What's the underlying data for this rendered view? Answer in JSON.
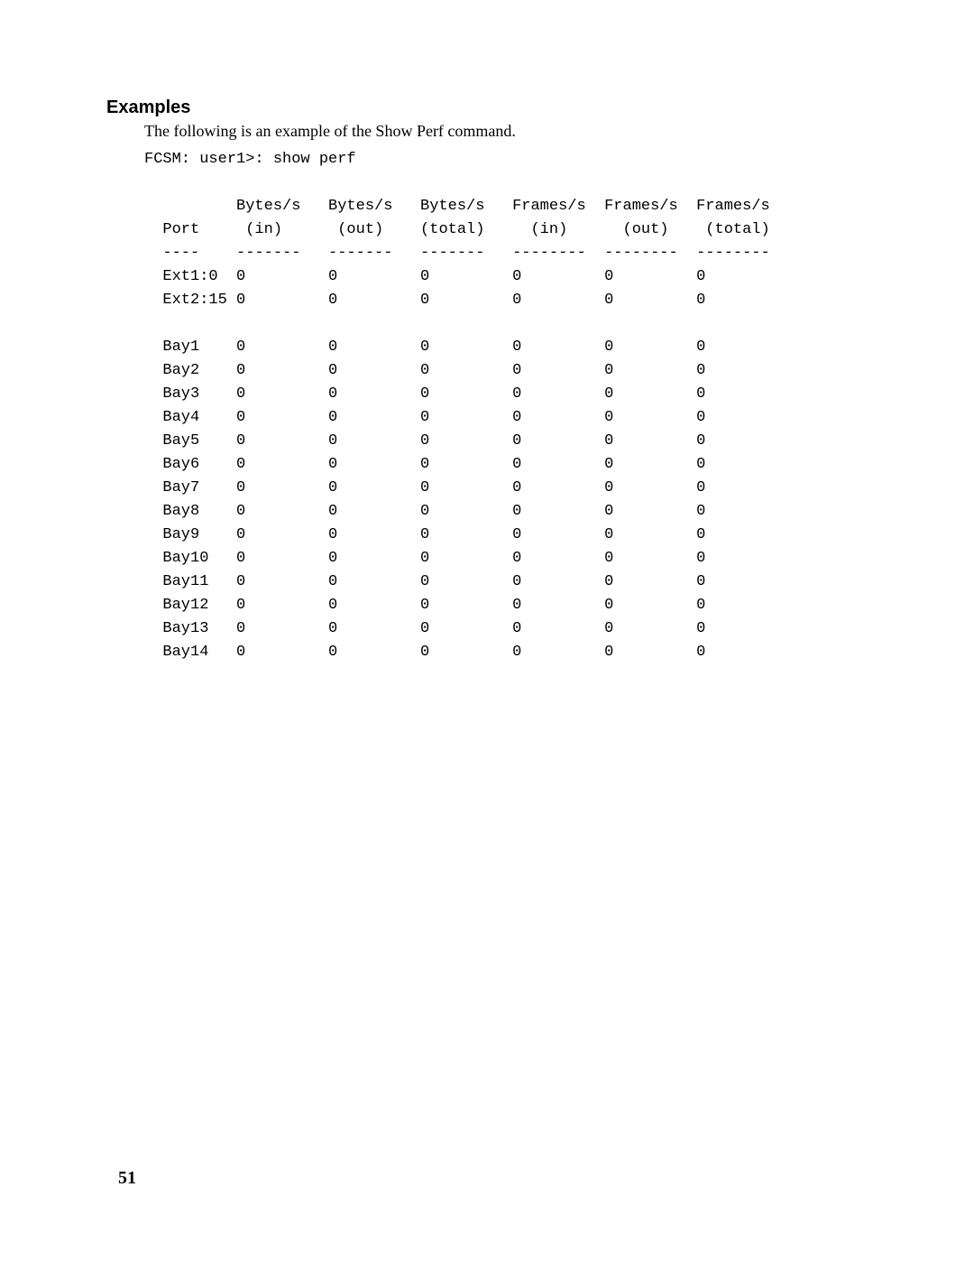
{
  "heading": "Examples",
  "intro": "The following is an example of the Show Perf command.",
  "prompt_line": "FCSM: user1>: show perf",
  "page_number": "51",
  "table_text": "          Bytes/s   Bytes/s   Bytes/s   Frames/s  Frames/s  Frames/s\n  Port     (in)      (out)    (total)     (in)      (out)    (total)\n  ----    -------   -------   -------   --------  --------  --------\n  Ext1:0  0         0         0         0         0         0\n  Ext2:15 0         0         0         0         0         0\n\n  Bay1    0         0         0         0         0         0\n  Bay2    0         0         0         0         0         0\n  Bay3    0         0         0         0         0         0\n  Bay4    0         0         0         0         0         0\n  Bay5    0         0         0         0         0         0\n  Bay6    0         0         0         0         0         0\n  Bay7    0         0         0         0         0         0\n  Bay8    0         0         0         0         0         0\n  Bay9    0         0         0         0         0         0\n  Bay10   0         0         0         0         0         0\n  Bay11   0         0         0         0         0         0\n  Bay12   0         0         0         0         0         0\n  Bay13   0         0         0         0         0         0\n  Bay14   0         0         0         0         0         0",
  "chart_data": {
    "type": "table",
    "columns": [
      "Port",
      "Bytes/s (in)",
      "Bytes/s (out)",
      "Bytes/s (total)",
      "Frames/s (in)",
      "Frames/s (out)",
      "Frames/s (total)"
    ],
    "rows": [
      [
        "Ext1:0",
        0,
        0,
        0,
        0,
        0,
        0
      ],
      [
        "Ext2:15",
        0,
        0,
        0,
        0,
        0,
        0
      ],
      [
        "Bay1",
        0,
        0,
        0,
        0,
        0,
        0
      ],
      [
        "Bay2",
        0,
        0,
        0,
        0,
        0,
        0
      ],
      [
        "Bay3",
        0,
        0,
        0,
        0,
        0,
        0
      ],
      [
        "Bay4",
        0,
        0,
        0,
        0,
        0,
        0
      ],
      [
        "Bay5",
        0,
        0,
        0,
        0,
        0,
        0
      ],
      [
        "Bay6",
        0,
        0,
        0,
        0,
        0,
        0
      ],
      [
        "Bay7",
        0,
        0,
        0,
        0,
        0,
        0
      ],
      [
        "Bay8",
        0,
        0,
        0,
        0,
        0,
        0
      ],
      [
        "Bay9",
        0,
        0,
        0,
        0,
        0,
        0
      ],
      [
        "Bay10",
        0,
        0,
        0,
        0,
        0,
        0
      ],
      [
        "Bay11",
        0,
        0,
        0,
        0,
        0,
        0
      ],
      [
        "Bay12",
        0,
        0,
        0,
        0,
        0,
        0
      ],
      [
        "Bay13",
        0,
        0,
        0,
        0,
        0,
        0
      ],
      [
        "Bay14",
        0,
        0,
        0,
        0,
        0,
        0
      ]
    ]
  }
}
